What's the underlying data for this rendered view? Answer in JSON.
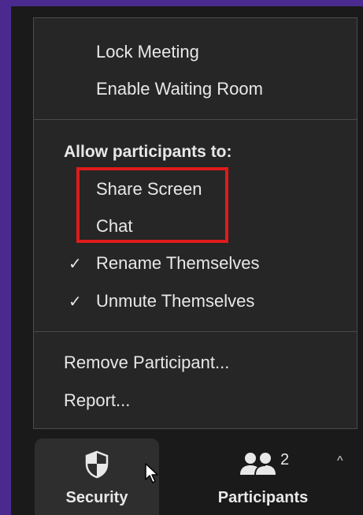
{
  "menu": {
    "lock_meeting": "Lock Meeting",
    "enable_waiting_room": "Enable Waiting Room",
    "allow_heading": "Allow participants to:",
    "share_screen": "Share Screen",
    "chat": "Chat",
    "rename_themselves": "Rename Themselves",
    "unmute_themselves": "Unmute Themselves",
    "check_glyph": "✓",
    "remove_participant": "Remove Participant...",
    "report": "Report..."
  },
  "toolbar": {
    "security_label": "Security",
    "participants_label": "Participants",
    "participants_count": "2",
    "caret_glyph": "^"
  },
  "colors": {
    "accent_purple": "#4b2a8f",
    "highlight_red": "#e01b1b",
    "menu_bg": "#262626"
  },
  "icons": {
    "security": "shield-icon",
    "participants": "participants-icon",
    "check": "checkmark-icon",
    "caret": "caret-up-icon",
    "cursor": "mouse-pointer-icon"
  }
}
